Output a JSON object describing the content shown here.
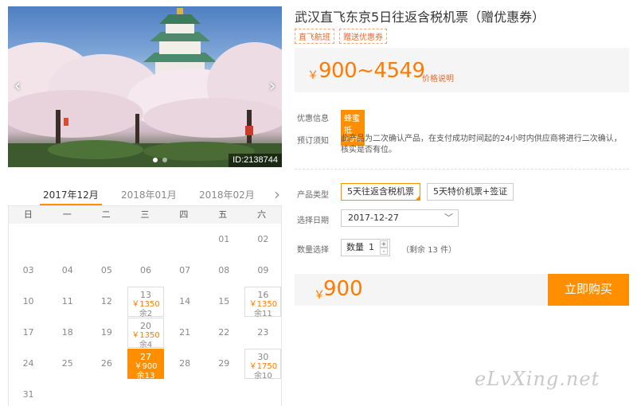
{
  "photo": {
    "id_label": "ID:2138744",
    "prev_icon": "chevron-left-icon",
    "next_icon": "chevron-right-icon",
    "slides": 2,
    "active_slide": 1
  },
  "calendar": {
    "tabs": [
      "2017年12月",
      "2018年01月",
      "2018年02月"
    ],
    "active_tab": 0,
    "weekdays": [
      "日",
      "一",
      "二",
      "三",
      "四",
      "五",
      "六"
    ],
    "days": [
      {
        "d": "01"
      },
      {
        "d": "02"
      },
      {
        "d": "03"
      },
      {
        "d": "04"
      },
      {
        "d": "05"
      },
      {
        "d": "06"
      },
      {
        "d": "07"
      },
      {
        "d": "08"
      },
      {
        "d": "09"
      },
      {
        "d": "10"
      },
      {
        "d": "11"
      },
      {
        "d": "12"
      },
      {
        "d": "13",
        "price": "￥1350",
        "stock": "余2"
      },
      {
        "d": "14"
      },
      {
        "d": "15"
      },
      {
        "d": "16",
        "price": "￥1350",
        "stock": "余11"
      },
      {
        "d": "17"
      },
      {
        "d": "18"
      },
      {
        "d": "19"
      },
      {
        "d": "20",
        "price": "￥1350",
        "stock": "余4"
      },
      {
        "d": "21"
      },
      {
        "d": "22"
      },
      {
        "d": "23"
      },
      {
        "d": "24"
      },
      {
        "d": "25"
      },
      {
        "d": "26"
      },
      {
        "d": "27",
        "price": "￥900",
        "stock": "余13",
        "selected": true
      },
      {
        "d": "28"
      },
      {
        "d": "29"
      },
      {
        "d": "30",
        "price": "￥1750",
        "stock": "余10"
      },
      {
        "d": "31"
      }
    ],
    "first_weekday": 5,
    "accent": "#ff8f00"
  },
  "product": {
    "title": "武汉直飞东京5日往返含税机票（赠优惠券）",
    "tags": [
      "直飞航班",
      "赠送优惠券"
    ],
    "price_yen": "￥",
    "price_range": "900~4549",
    "price_note": "价格说明",
    "discount_label": "优惠信息",
    "discount_badge": "蜂蜜抵10%",
    "notice_label": "预订须知",
    "notice_text": "此产品为二次确认产品，在支付成功时间起的24小时内供应商将进行二次确认，核实是否有位。"
  },
  "options": {
    "type_label": "产品类型",
    "types": [
      "5天往返含税机票",
      "5天特价机票+签证"
    ],
    "active_type": 0,
    "date_label": "选择日期",
    "date_value": "2017-12-27",
    "qty_label": "数量选择",
    "qty_prefix": "数量",
    "qty_value": "1",
    "qty_plus": "+",
    "qty_minus": "-",
    "stock_text": "（剩余 13 件）"
  },
  "buy": {
    "yen": "￥",
    "total": "900",
    "button": "立即购买"
  },
  "watermark": "eLvXing.net"
}
